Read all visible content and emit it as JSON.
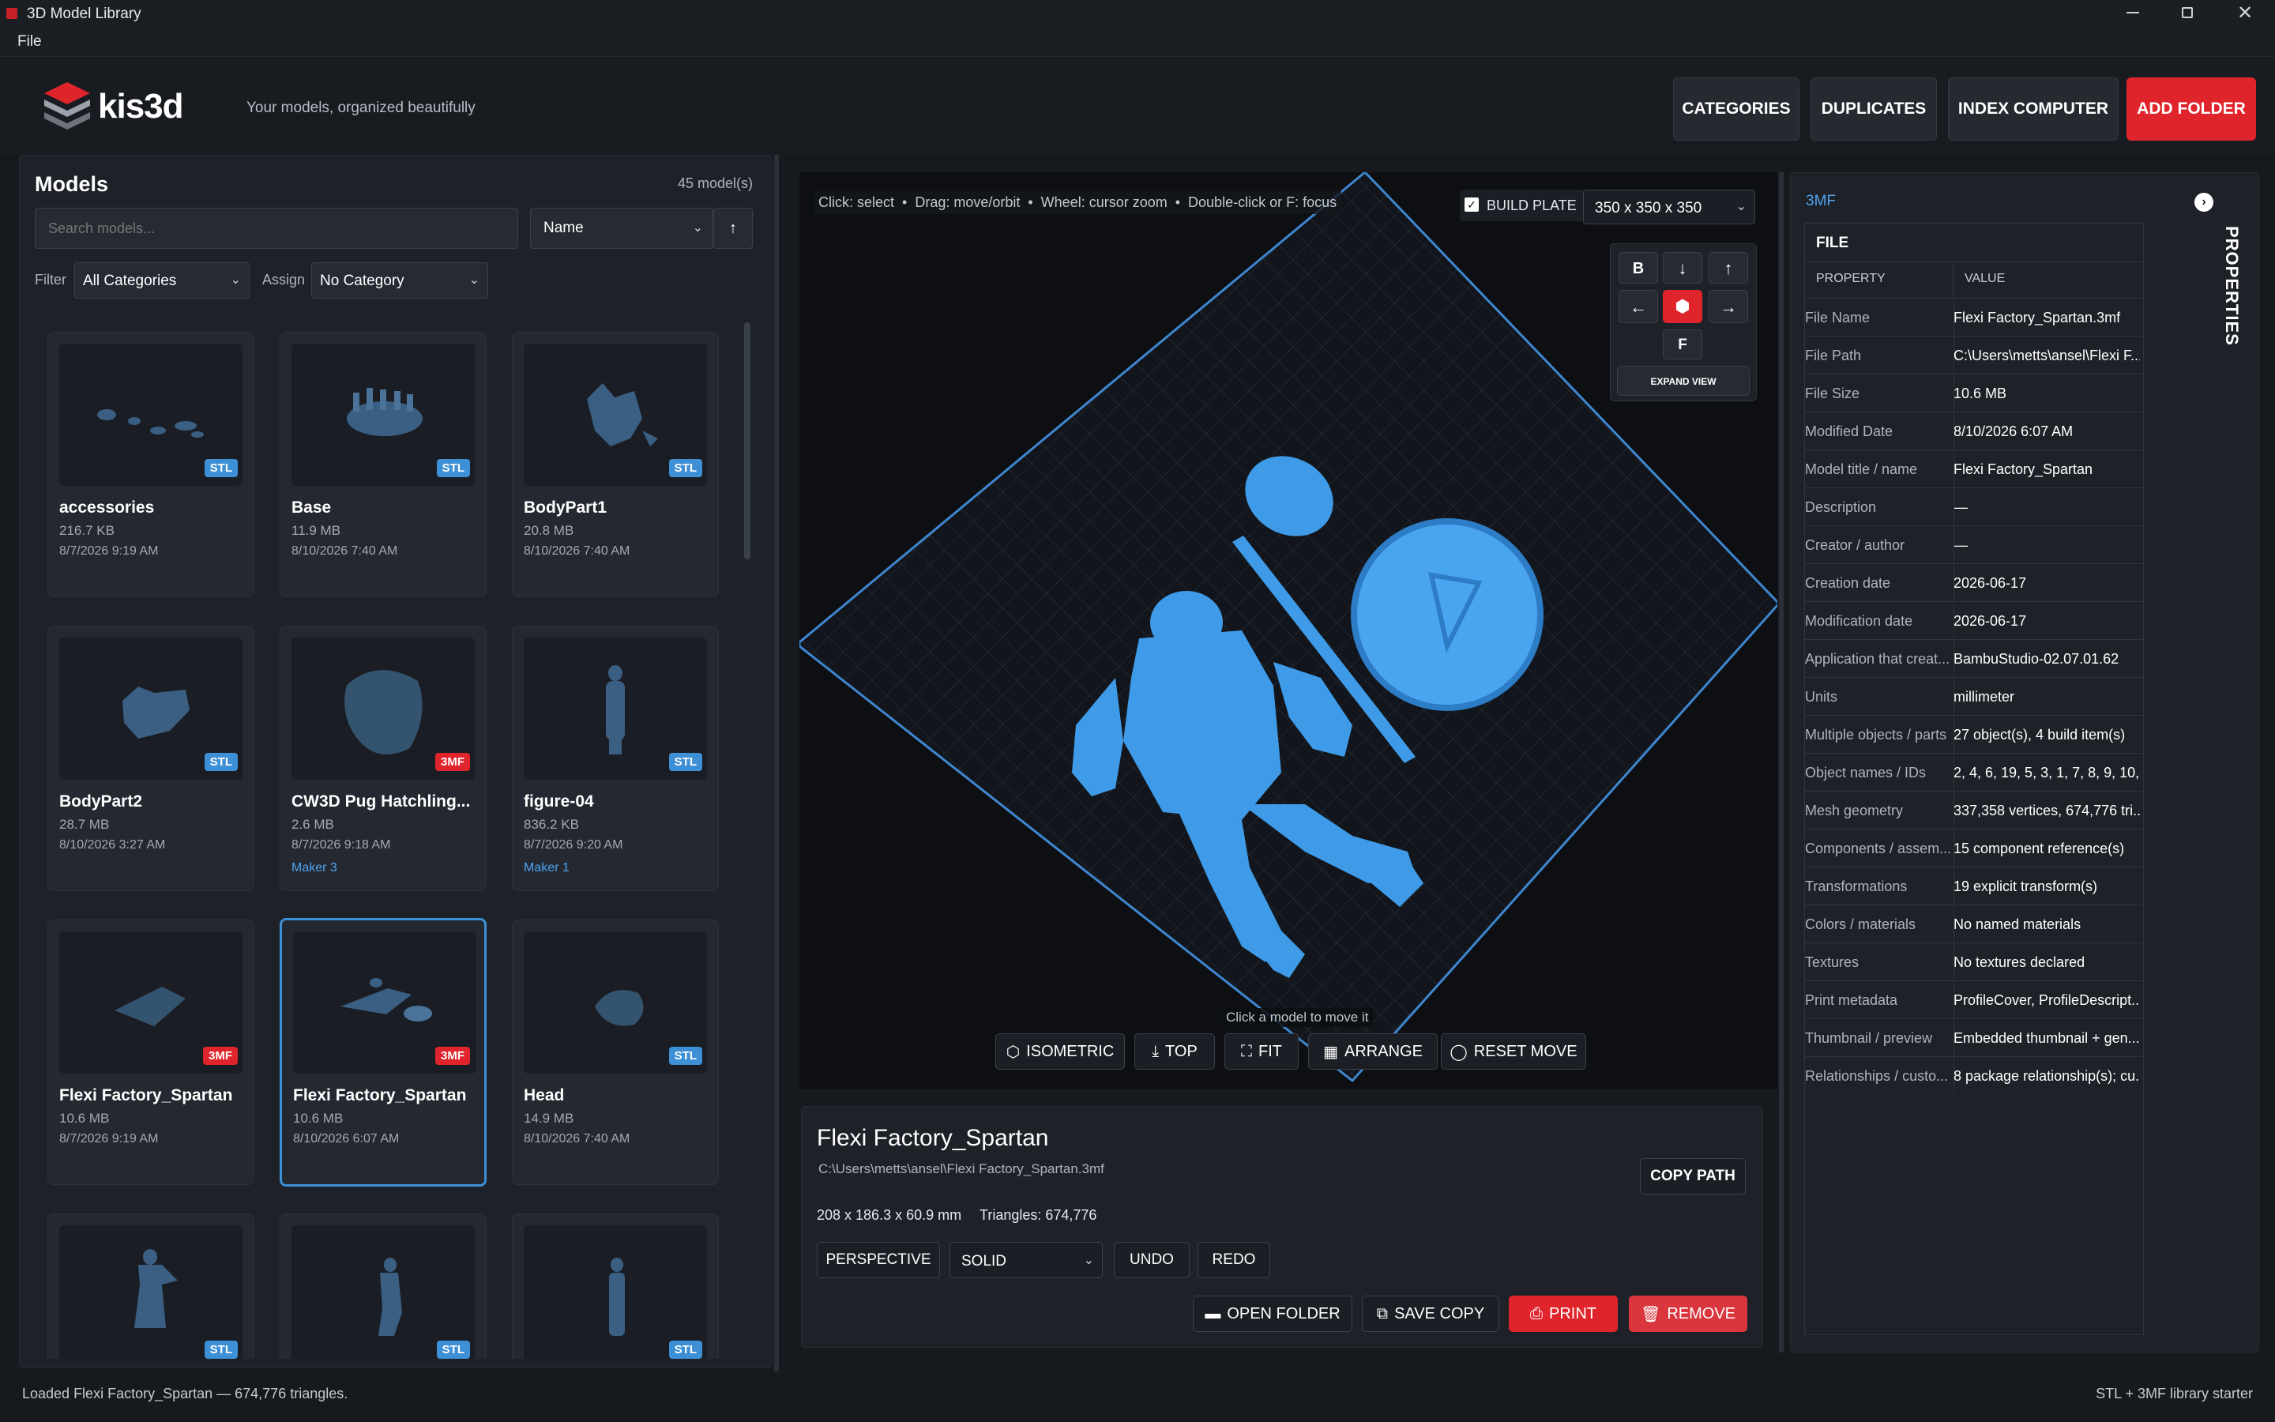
{
  "window": {
    "title": "3D Model Library"
  },
  "menu": {
    "file": "File"
  },
  "header": {
    "logo_text": "kis3d",
    "tagline": "Your models, organized beautifully",
    "buttons": {
      "categories": "CATEGORIES",
      "duplicates": "DUPLICATES",
      "index": "INDEX COMPUTER",
      "add_folder": "ADD FOLDER"
    }
  },
  "models_panel": {
    "title": "Models",
    "count": "45 model(s)",
    "search_placeholder": "Search models...",
    "sort_value": "Name",
    "sort_dir_icon": "↑",
    "filter_label": "Filter",
    "filter_value": "All Categories",
    "assign_label": "Assign",
    "assign_value": "No Category",
    "cards": [
      {
        "name": "accessories",
        "size": "216.7 KB",
        "date": "8/7/2026 9:19 AM",
        "badge": "STL",
        "maker": ""
      },
      {
        "name": "Base",
        "size": "11.9 MB",
        "date": "8/10/2026 7:40 AM",
        "badge": "STL",
        "maker": ""
      },
      {
        "name": "BodyPart1",
        "size": "20.8 MB",
        "date": "8/10/2026 7:40 AM",
        "badge": "STL",
        "maker": ""
      },
      {
        "name": "BodyPart2",
        "size": "28.7 MB",
        "date": "8/10/2026 3:27 AM",
        "badge": "STL",
        "maker": ""
      },
      {
        "name": "CW3D Pug Hatchling...",
        "size": "2.6 MB",
        "date": "8/7/2026 9:18 AM",
        "badge": "3MF",
        "maker": "Maker 3"
      },
      {
        "name": "figure-04",
        "size": "836.2 KB",
        "date": "8/7/2026 9:20 AM",
        "badge": "STL",
        "maker": "Maker 1"
      },
      {
        "name": "Flexi Factory_Spartan",
        "size": "10.6 MB",
        "date": "8/7/2026 9:19 AM",
        "badge": "3MF",
        "maker": ""
      },
      {
        "name": "Flexi Factory_Spartan",
        "size": "10.6 MB",
        "date": "8/10/2026 6:07 AM",
        "badge": "3MF",
        "maker": ""
      },
      {
        "name": "Head",
        "size": "14.9 MB",
        "date": "8/10/2026 7:40 AM",
        "badge": "STL",
        "maker": ""
      },
      {
        "name": "",
        "size": "",
        "date": "",
        "badge": "STL",
        "maker": ""
      },
      {
        "name": "",
        "size": "",
        "date": "",
        "badge": "STL",
        "maker": ""
      },
      {
        "name": "",
        "size": "",
        "date": "",
        "badge": "STL",
        "maker": ""
      }
    ]
  },
  "viewport": {
    "hint": "Click: select  •  Drag: move/orbit  •  Wheel: cursor zoom  •  Double-click or F: focus",
    "build_plate_label": "BUILD PLATE",
    "build_plate_value": "350 x 350 x 350",
    "nav": {
      "back": "B",
      "focus": "F",
      "expand": "EXPAND VIEW"
    },
    "bottom_hint": "Click a model to move it",
    "toolbar": {
      "isometric": "ISOMETRIC",
      "top": "TOP",
      "fit": "FIT",
      "arrange": "ARRANGE",
      "reset": "RESET MOVE"
    }
  },
  "details": {
    "name": "Flexi Factory_Spartan",
    "path": "C:\\Users\\metts\\ansel\\Flexi Factory_Spartan.3mf",
    "dims": "208 x 186.3 x 60.9 mm",
    "triangles": "Triangles: 674,776",
    "copy_path": "COPY PATH",
    "perspective": "PERSPECTIVE",
    "shading": "SOLID",
    "undo": "UNDO",
    "redo": "REDO",
    "open_folder": "OPEN FOLDER",
    "save_copy": "SAVE COPY",
    "print": "PRINT",
    "remove": "REMOVE"
  },
  "properties": {
    "format": "3MF",
    "section": "FILE",
    "col_property": "PROPERTY",
    "col_value": "VALUE",
    "side_label": "PROPERTIES",
    "rows": [
      {
        "k": "File Name",
        "v": "Flexi Factory_Spartan.3mf"
      },
      {
        "k": "File Path",
        "v": "C:\\Users\\metts\\ansel\\Flexi F..."
      },
      {
        "k": "File Size",
        "v": "10.6 MB"
      },
      {
        "k": "Modified Date",
        "v": "8/10/2026 6:07 AM"
      },
      {
        "k": "Model title / name",
        "v": "Flexi Factory_Spartan"
      },
      {
        "k": "Description",
        "v": "—"
      },
      {
        "k": "Creator / author",
        "v": "—"
      },
      {
        "k": "Creation date",
        "v": "2026-06-17"
      },
      {
        "k": "Modification date",
        "v": "2026-06-17"
      },
      {
        "k": "Application that creat...",
        "v": "BambuStudio-02.07.01.62"
      },
      {
        "k": "Units",
        "v": "millimeter"
      },
      {
        "k": "Multiple objects / parts",
        "v": "27 object(s), 4 build item(s)"
      },
      {
        "k": "Object names / IDs",
        "v": "2, 4, 6, 19, 5, 3, 1, 7, 8, 9, 10,..."
      },
      {
        "k": "Mesh geometry",
        "v": "337,358 vertices, 674,776 tri..."
      },
      {
        "k": "Components / assem...",
        "v": "15 component reference(s)"
      },
      {
        "k": "Transformations",
        "v": "19 explicit transform(s)"
      },
      {
        "k": "Colors / materials",
        "v": "No named materials"
      },
      {
        "k": "Textures",
        "v": "No textures declared"
      },
      {
        "k": "Print metadata",
        "v": "ProfileCover, ProfileDescript..."
      },
      {
        "k": "Thumbnail / preview",
        "v": "Embedded thumbnail + gen..."
      },
      {
        "k": "Relationships / custo...",
        "v": "8 package relationship(s); cu..."
      }
    ]
  },
  "status": {
    "left": "Loaded Flexi Factory_Spartan — 674,776 triangles.",
    "right": "STL + 3MF library starter"
  },
  "colors": {
    "accent_red": "#e0242b",
    "accent_blue": "#3d8fd6",
    "model_blue": "#3f9be8"
  }
}
